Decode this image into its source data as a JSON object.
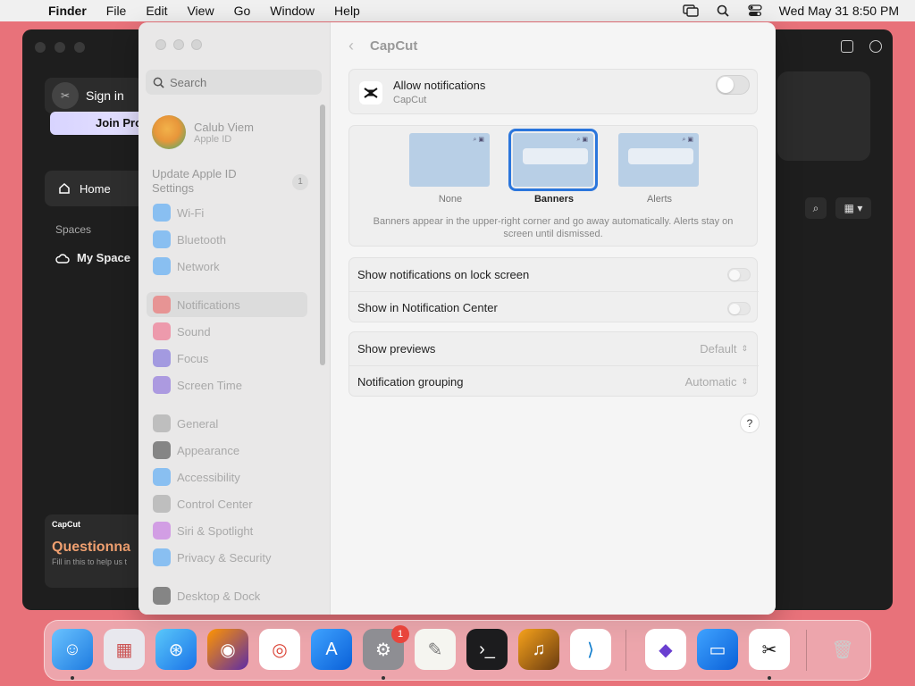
{
  "menubar": {
    "app": "Finder",
    "items": [
      "File",
      "Edit",
      "View",
      "Go",
      "Window",
      "Help"
    ],
    "clock": "Wed May 31  8:50 PM"
  },
  "capcut": {
    "sign_in": "Sign in",
    "join": "Join Pro",
    "home": "Home",
    "spaces": "Spaces",
    "my_space": "My Space",
    "promo_logo": "CapCut",
    "promo_title": "Questionna",
    "promo_sub": "Fill in this to help us t"
  },
  "sidebar": {
    "search_placeholder": "Search",
    "user_name": "Calub Viem",
    "user_sub": "Apple ID",
    "update_label": "Update Apple ID Settings",
    "update_badge": "1",
    "items": [
      {
        "label": "Wi-Fi",
        "color": "#3b9cf7",
        "icon": "wifi-icon"
      },
      {
        "label": "Bluetooth",
        "color": "#3b9cf7",
        "icon": "bluetooth-icon"
      },
      {
        "label": "Network",
        "color": "#3b9cf7",
        "icon": "globe-icon"
      },
      {
        "label": "Notifications",
        "color": "#f05a5a",
        "icon": "bell-icon"
      },
      {
        "label": "Sound",
        "color": "#f05a7a",
        "icon": "speaker-icon"
      },
      {
        "label": "Focus",
        "color": "#6a5ad8",
        "icon": "moon-icon"
      },
      {
        "label": "Screen Time",
        "color": "#7a5ad8",
        "icon": "hourglass-icon"
      },
      {
        "label": "General",
        "color": "#9a9a9a",
        "icon": "gear-icon"
      },
      {
        "label": "Appearance",
        "color": "#333333",
        "icon": "appearance-icon"
      },
      {
        "label": "Accessibility",
        "color": "#3b9cf7",
        "icon": "accessibility-icon"
      },
      {
        "label": "Control Center",
        "color": "#9a9a9a",
        "icon": "control-center-icon"
      },
      {
        "label": "Siri & Spotlight",
        "color": "#c060e0",
        "icon": "siri-icon"
      },
      {
        "label": "Privacy & Security",
        "color": "#3b9cf7",
        "icon": "hand-icon"
      },
      {
        "label": "Desktop & Dock",
        "color": "#333333",
        "icon": "dock-icon"
      }
    ]
  },
  "main": {
    "title": "CapCut",
    "allow_label": "Allow notifications",
    "allow_sub": "CapCut",
    "styles": [
      "None",
      "Banners",
      "Alerts"
    ],
    "selected_style": "Banners",
    "style_desc": "Banners appear in the upper-right corner and go away automatically. Alerts stay on screen until dismissed.",
    "lock_screen": "Show notifications on lock screen",
    "notif_center": "Show in Notification Center",
    "previews_label": "Show previews",
    "previews_value": "Default",
    "grouping_label": "Notification grouping",
    "grouping_value": "Automatic",
    "help": "?"
  },
  "dock": {
    "settings_badge": "1",
    "apps": [
      "Finder",
      "Launchpad",
      "Safari",
      "Firefox",
      "Chrome",
      "App Store",
      "System Settings",
      "TextEdit",
      "Terminal",
      "GarageBand",
      "VS Code",
      "Visual Studio",
      "Keynote",
      "CapCut",
      "Trash"
    ]
  }
}
